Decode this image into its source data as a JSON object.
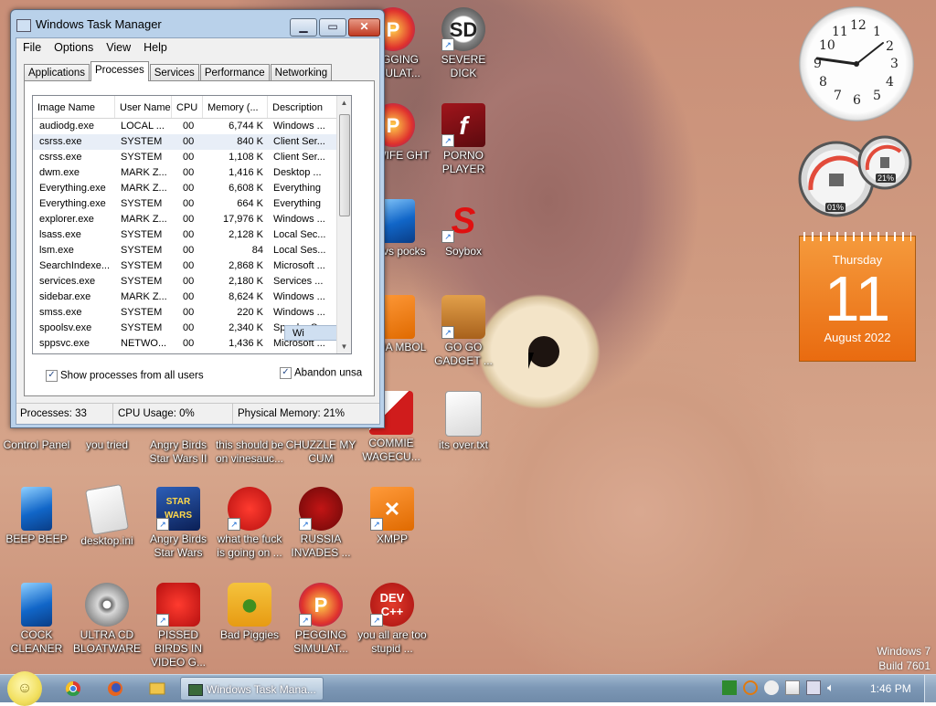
{
  "taskmgr": {
    "title": "Windows Task Manager",
    "menu": [
      "File",
      "Options",
      "View",
      "Help"
    ],
    "tabs": [
      "Applications",
      "Processes",
      "Services",
      "Performance",
      "Networking"
    ],
    "columns": [
      "Image Name",
      "User Name",
      "CPU",
      "Memory (...",
      "Description"
    ],
    "rows": [
      [
        "audiodg.exe",
        "LOCAL ...",
        "00",
        "6,744 K",
        "Windows ..."
      ],
      [
        "csrss.exe",
        "SYSTEM",
        "00",
        "840 K",
        "Client Ser..."
      ],
      [
        "csrss.exe",
        "SYSTEM",
        "00",
        "1,108 K",
        "Client Ser..."
      ],
      [
        "dwm.exe",
        "MARK Z...",
        "00",
        "1,416 K",
        "Desktop ..."
      ],
      [
        "Everything.exe",
        "MARK Z...",
        "00",
        "6,608 K",
        "Everything"
      ],
      [
        "Everything.exe",
        "SYSTEM",
        "00",
        "664 K",
        "Everything"
      ],
      [
        "explorer.exe",
        "MARK Z...",
        "00",
        "17,976 K",
        "Windows ..."
      ],
      [
        "lsass.exe",
        "SYSTEM",
        "00",
        "2,128 K",
        "Local Sec..."
      ],
      [
        "lsm.exe",
        "SYSTEM",
        "00",
        "84",
        "Local Ses..."
      ],
      [
        "SearchIndexe...",
        "SYSTEM",
        "00",
        "2,868 K",
        "Microsoft ..."
      ],
      [
        "services.exe",
        "SYSTEM",
        "00",
        "2,180 K",
        "Services ..."
      ],
      [
        "sidebar.exe",
        "MARK Z...",
        "00",
        "8,624 K",
        "Windows ..."
      ],
      [
        "smss.exe",
        "SYSTEM",
        "00",
        "220 K",
        "Windows ..."
      ],
      [
        "spoolsv.exe",
        "SYSTEM",
        "00",
        "2,340 K",
        "Spooler S..."
      ],
      [
        "sppsvc.exe",
        "NETWO...",
        "00",
        "1,436 K",
        "Microsoft ..."
      ]
    ],
    "tooltip_fragment": "Wi",
    "show_all_label": "Show processes from all users",
    "abandon_label": "Abandon unsa",
    "status": {
      "processes": "Processes: 33",
      "cpu": "CPU Usage: 0%",
      "memory": "Physical Memory: 21%"
    }
  },
  "desktop_icons": [
    {
      "label": "PEGGING SIMULAT...",
      "icon": "pegging-icon"
    },
    {
      "label": "SEVERE DICK",
      "icon": "sd-gear-icon"
    },
    {
      "label": "MY WIFE GHT",
      "icon": "my-wife-icon"
    },
    {
      "label": "PORNO PLAYER",
      "icon": "flash-player-icon"
    },
    {
      "label": "ises vs pocks",
      "icon": "ises-icon"
    },
    {
      "label": "Soybox",
      "icon": "soybox-icon"
    },
    {
      "label": "USSIA MBOL",
      "icon": "russia-symbol-icon"
    },
    {
      "label": "GO GO GADGET ...",
      "icon": "briefcase-icon"
    },
    {
      "label": "COMMIE WAGECU...",
      "icon": "commie-icon"
    },
    {
      "label": "its over.txt",
      "icon": "text-file-icon"
    },
    {
      "label": "Control Panel",
      "icon": "control-panel-icon"
    },
    {
      "label": "you tried",
      "icon": "you-tried-icon"
    },
    {
      "label": "Angry Birds Star Wars II",
      "icon": "angry-birds-sw2-icon"
    },
    {
      "label": "this should be on vinesauc...",
      "icon": "vinesauce-icon"
    },
    {
      "label": "CHUZZLE MY CUM",
      "icon": "chuzzle-icon"
    },
    {
      "label": "BEEP BEEP",
      "icon": "beep-icon"
    },
    {
      "label": "desktop.ini",
      "icon": "ini-file-icon"
    },
    {
      "label": "Angry Birds Star Wars",
      "icon": "angry-birds-sw-icon"
    },
    {
      "label": "what the fuck is going on ...",
      "icon": "angry-bird-red-icon"
    },
    {
      "label": "RUSSIA INVADES ...",
      "icon": "russia-invades-icon"
    },
    {
      "label": "XMPP",
      "icon": "xampp-icon"
    },
    {
      "label": "COCK CLEANER",
      "icon": "cleaner-icon"
    },
    {
      "label": "ULTRA CD BLOATWARE",
      "icon": "cd-icon"
    },
    {
      "label": "PISSED BIRDS IN VIDEO G...",
      "icon": "pissed-birds-icon"
    },
    {
      "label": "Bad Piggies",
      "icon": "bad-piggies-icon"
    },
    {
      "label": "PEGGING SIMULAT...",
      "icon": "pegging-icon"
    },
    {
      "label": "you all are too stupid ...",
      "icon": "devcpp-icon"
    }
  ],
  "gadgets": {
    "clock_numbers": [
      "12",
      "1",
      "2",
      "3",
      "4",
      "5",
      "6",
      "7",
      "8",
      "9",
      "10",
      "11"
    ],
    "cpu_meter": "01%",
    "memory_meter": "21%",
    "calendar": {
      "weekday": "Thursday",
      "day": "11",
      "month_year": "August 2022"
    }
  },
  "watermark": {
    "line1": "Windows 7",
    "line2": "Build 7601"
  },
  "taskbar": {
    "active_app": "Windows Task Mana...",
    "time": "1:46 PM"
  },
  "colors": {
    "accent": "#e96b10",
    "titlebar": "#b9d1ea"
  }
}
